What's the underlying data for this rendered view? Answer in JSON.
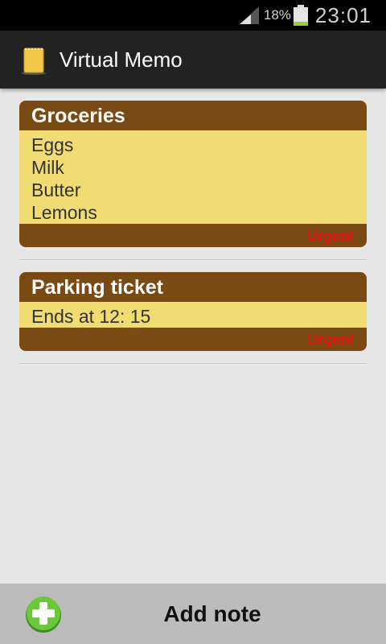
{
  "status_bar": {
    "battery_percent": "18%",
    "time": "23:01",
    "signal_icon": "signal-icon",
    "battery_icon": "battery-icon",
    "battery_level": 0.18
  },
  "action_bar": {
    "app_icon": "notepad-icon",
    "title": "Virtual Memo"
  },
  "notes": [
    {
      "title": "Groceries",
      "lines": [
        "Eggs",
        "Milk",
        "Butter",
        "Lemons"
      ],
      "priority": "Urgent"
    },
    {
      "title": "Parking ticket",
      "lines": [
        "Ends at 12: 15"
      ],
      "priority": "Urgent"
    }
  ],
  "bottom_bar": {
    "add_icon": "add-icon",
    "label": "Add note"
  },
  "colors": {
    "note_header": "#7a4a14",
    "note_body": "#f0dc72",
    "urgent": "#ee1111",
    "background": "#e6e6e6",
    "add_icon": "#5dbb2f"
  }
}
